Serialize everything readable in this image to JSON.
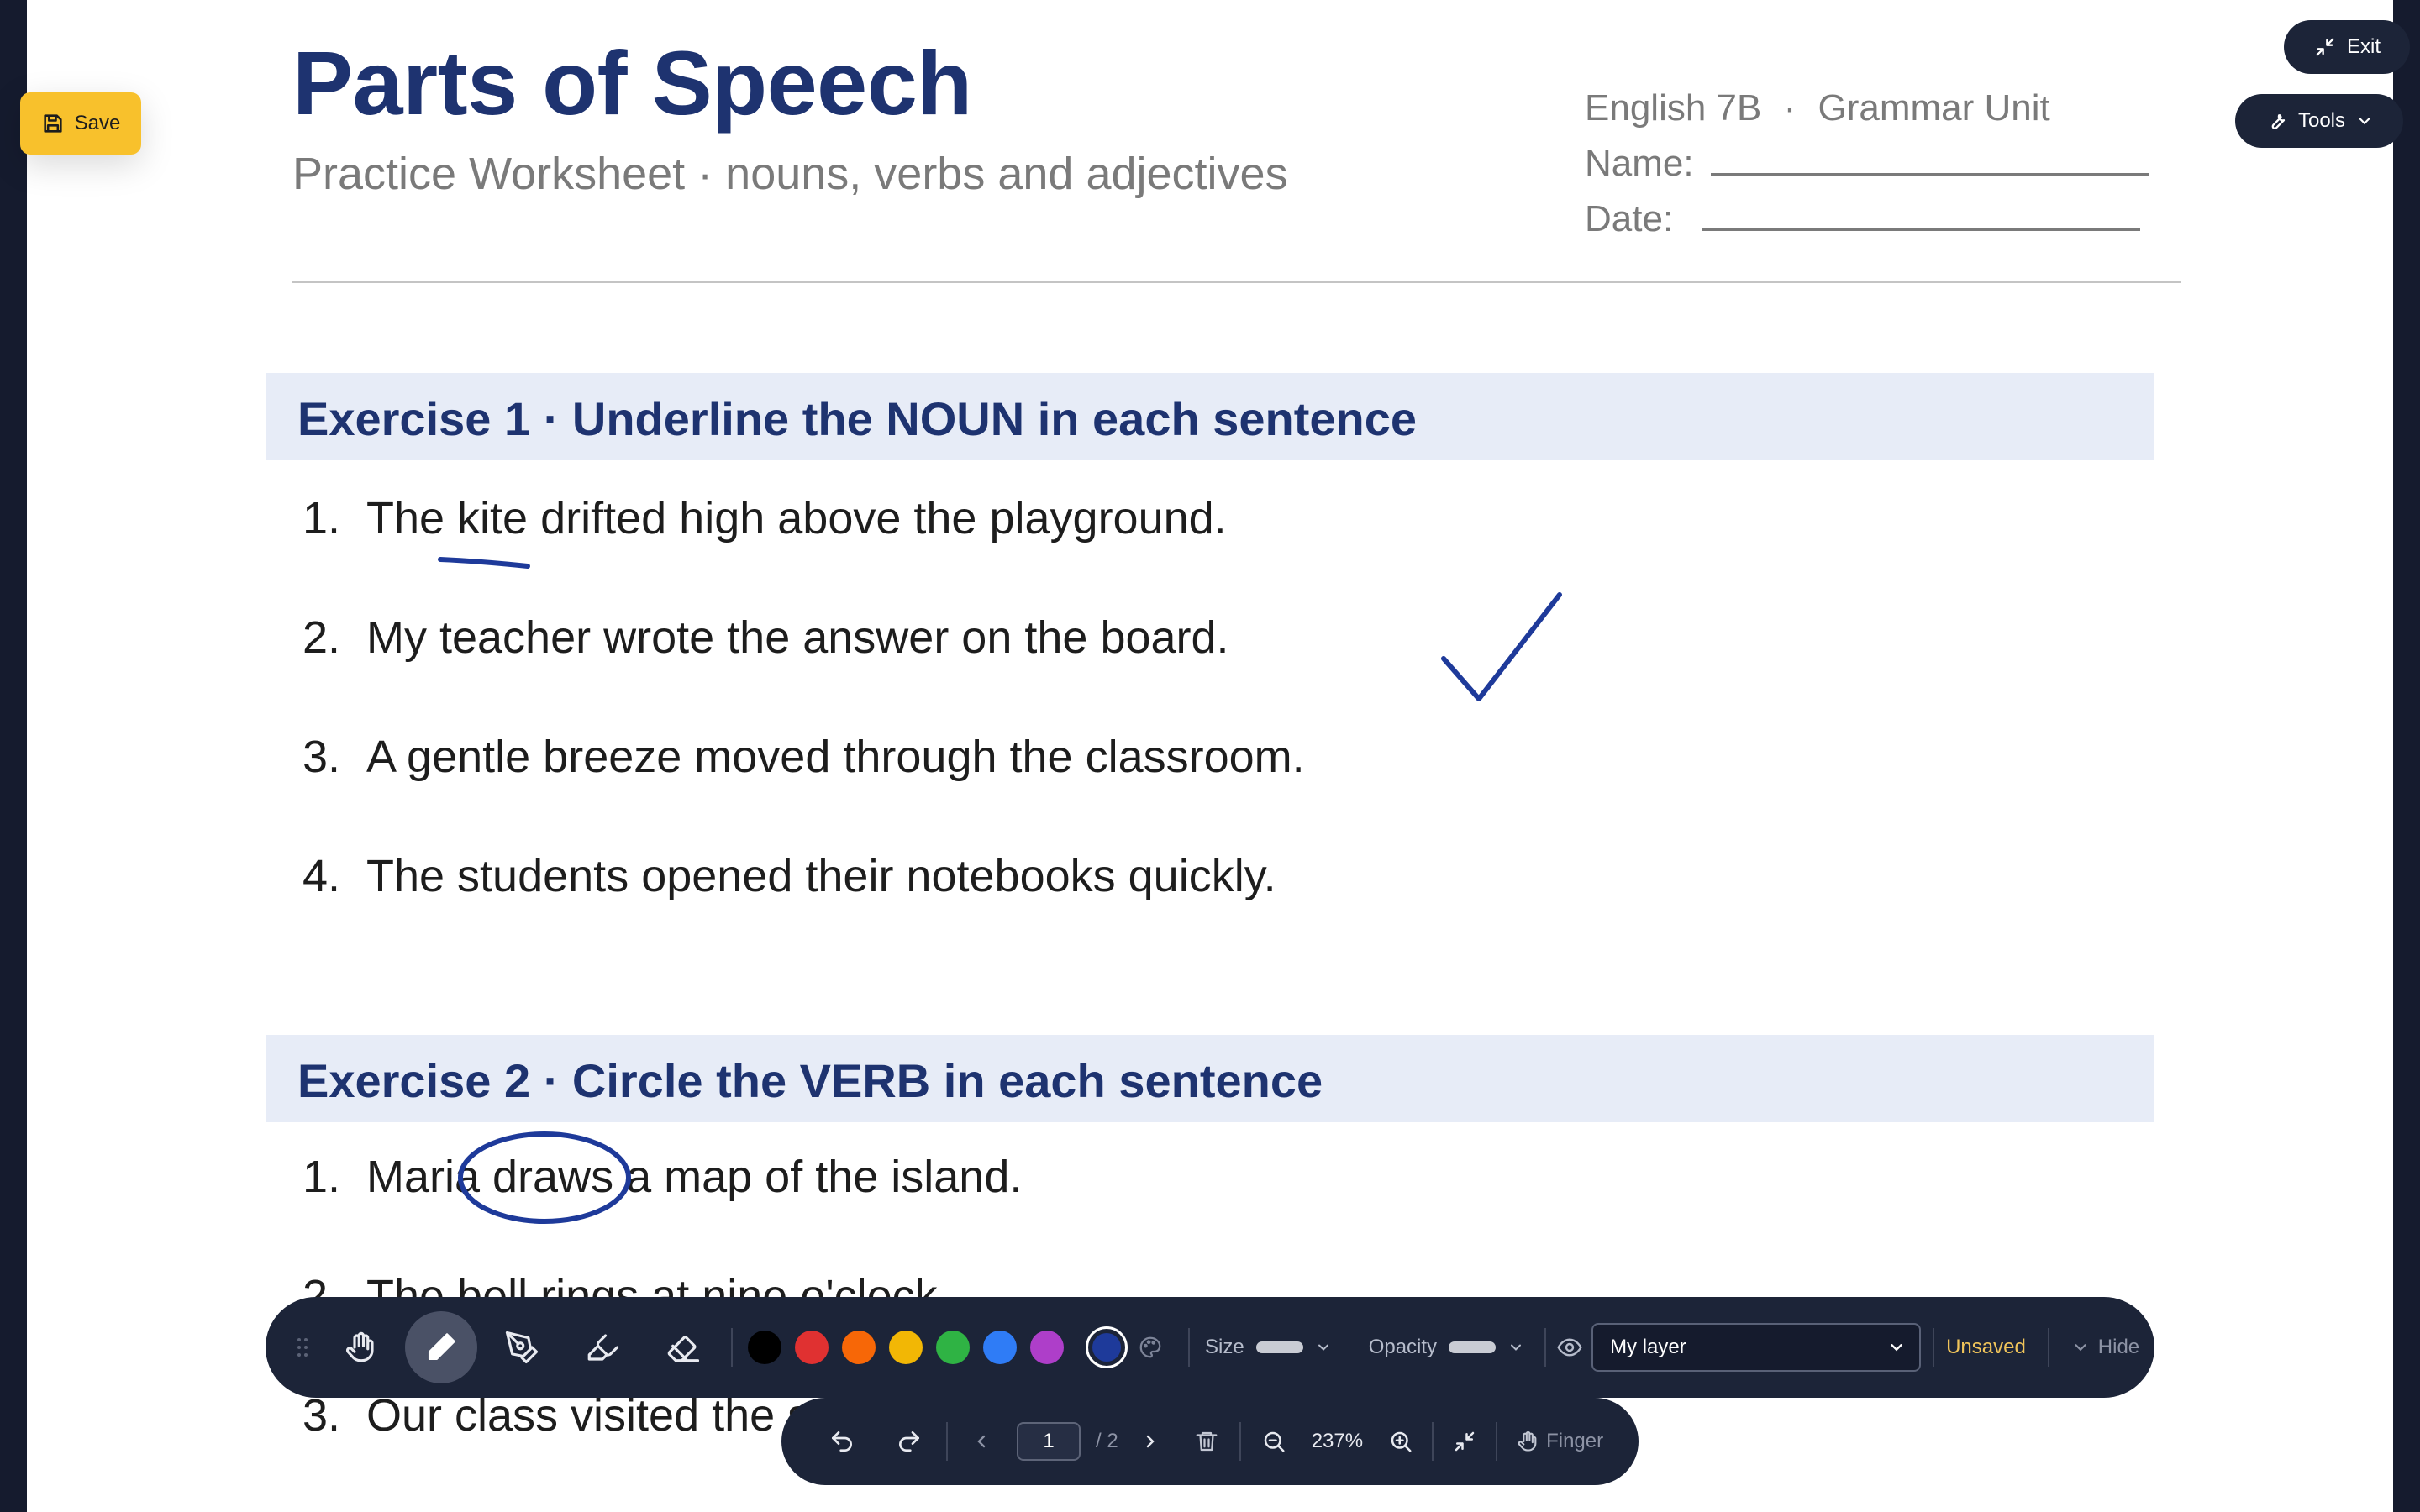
{
  "header": {
    "title": "Parts of Speech",
    "subtitle": "Practice Worksheet · nouns, verbs and adjectives",
    "course": "English 7B",
    "unit": "Grammar Unit",
    "separator": "·",
    "name_label": "Name:",
    "date_label": "Date:"
  },
  "exercises": [
    {
      "heading": "Exercise 1 · Underline the NOUN in each sentence",
      "sentences": [
        {
          "num": "1.",
          "text": "The kite drifted high above the playground."
        },
        {
          "num": "2.",
          "text": "My teacher wrote the answer on the board."
        },
        {
          "num": "3.",
          "text": "A gentle breeze moved through the classroom."
        },
        {
          "num": "4.",
          "text": "The students opened their notebooks quickly."
        }
      ]
    },
    {
      "heading": "Exercise 2 · Circle the VERB in each sentence",
      "sentences": [
        {
          "num": "1.",
          "text": "Maria draws a map of the island."
        },
        {
          "num": "2.",
          "text": "The bell rings at nine o'clock."
        },
        {
          "num": "3.",
          "text": "Our class visited the science museum."
        }
      ]
    }
  ],
  "buttons": {
    "save": "Save",
    "exit": "Exit",
    "tools": "Tools"
  },
  "toolbar": {
    "tools": [
      "hand-icon",
      "pencil-icon",
      "pen-icon",
      "highlighter-icon",
      "eraser-icon"
    ],
    "active_tool": "pencil-icon",
    "colors": [
      "#000000",
      "#e03131",
      "#f76707",
      "#f2b705",
      "#2fb344",
      "#2f7cf6",
      "#ae3ec9"
    ],
    "selected_color": "#1e3a9a",
    "size_label": "Size",
    "opacity_label": "Opacity",
    "layer": "My layer",
    "status": "Unsaved",
    "hide_label": "Hide"
  },
  "pager": {
    "current_page": "1",
    "total_pages": "/ 2",
    "zoom": "237%",
    "input_mode": "Finger"
  },
  "colors": {
    "ink": "#1e3a9a",
    "accent": "#f8c12c",
    "toolbar_bg": "#1c2438",
    "title": "#1e3370"
  }
}
